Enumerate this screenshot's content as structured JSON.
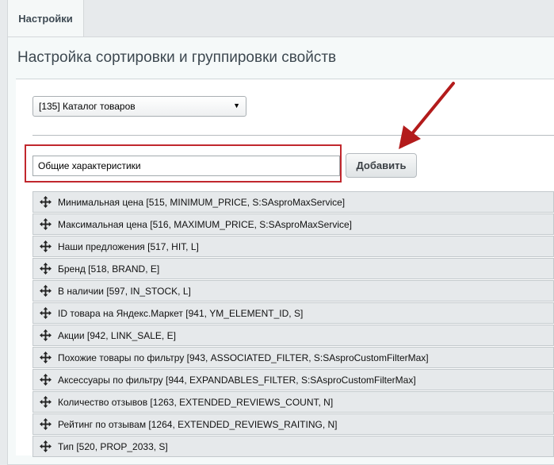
{
  "tabs": [
    {
      "label": "Настройки"
    }
  ],
  "page": {
    "title": "Настройка сортировки и группировки свойств"
  },
  "catalog_select": {
    "selected": "[135] Каталог товаров"
  },
  "group": {
    "input_value": "Общие характеристики",
    "add_button_label": "Добавить"
  },
  "properties": [
    {
      "label": "Минимальная цена [515, MINIMUM_PRICE, S:SAsproMaxService]"
    },
    {
      "label": "Максимальная цена [516, MAXIMUM_PRICE, S:SAsproMaxService]"
    },
    {
      "label": "Наши предложения [517, HIT, L]"
    },
    {
      "label": "Бренд [518, BRAND, E]"
    },
    {
      "label": "В наличии [597, IN_STOCK, L]"
    },
    {
      "label": "ID товара на Яндекс.Маркет [941, YM_ELEMENT_ID, S]"
    },
    {
      "label": "Акции [942, LINK_SALE, E]"
    },
    {
      "label": "Похожие товары по фильтру [943, ASSOCIATED_FILTER, S:SAsproCustomFilterMax]"
    },
    {
      "label": "Аксессуары по фильтру [944, EXPANDABLES_FILTER, S:SAsproCustomFilterMax]"
    },
    {
      "label": "Количество отзывов [1263, EXTENDED_REVIEWS_COUNT, N]"
    },
    {
      "label": "Рейтинг по отзывам [1264, EXTENDED_REVIEWS_RAITING, N]"
    },
    {
      "label": "Тип [520, PROP_2033, S]"
    }
  ],
  "icons": {
    "drag_handle": "move-arrows-icon",
    "select_arrow": "dropdown-triangle-icon"
  },
  "colors": {
    "highlight_box": "#c1272d",
    "annotation_arrow": "#b31b1b"
  }
}
